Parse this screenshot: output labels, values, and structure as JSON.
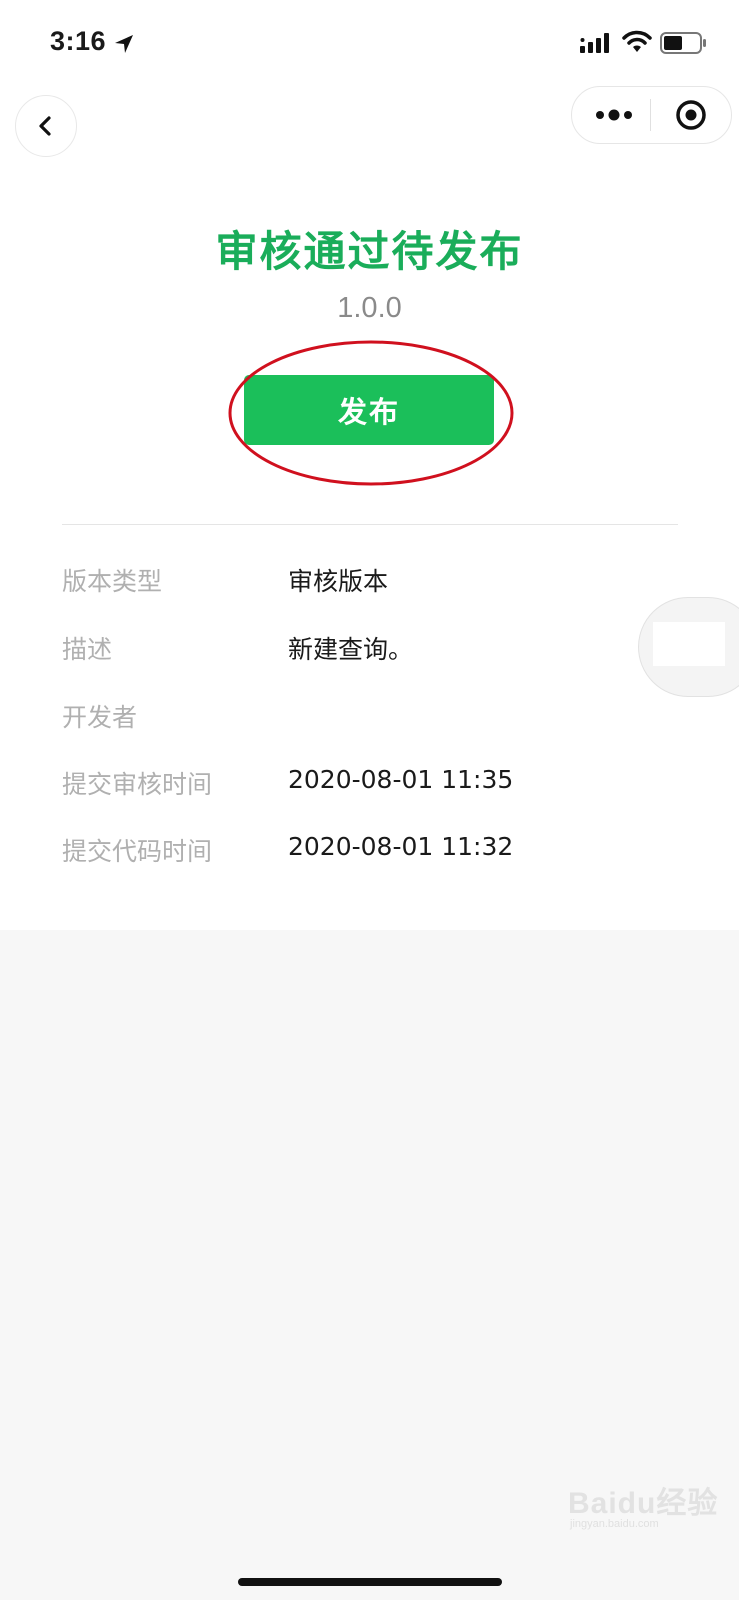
{
  "status_bar": {
    "time": "3:16"
  },
  "nav": {
    "back_icon": "chevron-left-icon",
    "more_icon": "more-dots-icon",
    "close_icon": "target-circle-icon"
  },
  "header": {
    "status_title": "审核通过待发布",
    "version": "1.0.0",
    "publish_label": "发布"
  },
  "info": [
    {
      "label": "版本类型",
      "value": "审核版本"
    },
    {
      "label": "描述",
      "value": "新建查询。"
    },
    {
      "label": "开发者",
      "value": ""
    },
    {
      "label": "提交审核时间",
      "value": "2020-08-01 11:35"
    },
    {
      "label": "提交代码时间",
      "value": "2020-08-01 11:32"
    }
  ],
  "watermark": {
    "brand": "Baidu经验",
    "url": "jingyan.baidu.com"
  },
  "colors": {
    "accent_green": "#1aad5a",
    "button_green": "#1bbf5a",
    "annotation_red": "#d0101e"
  }
}
